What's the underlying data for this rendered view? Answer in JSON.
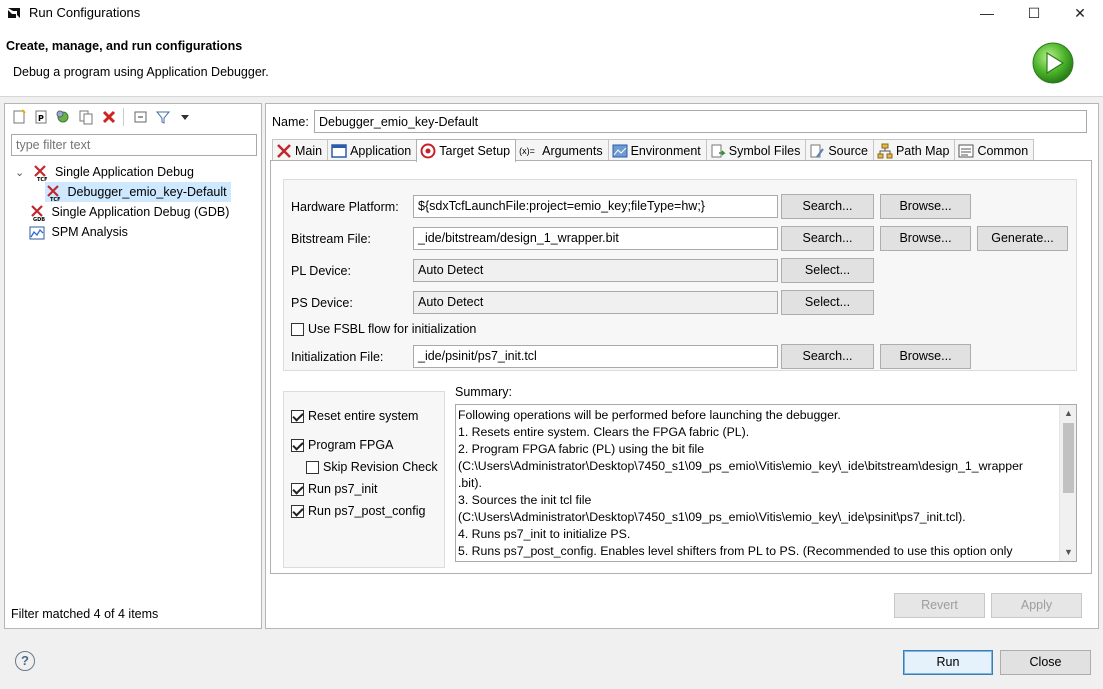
{
  "window": {
    "title": "Run Configurations",
    "controls": {
      "minimize": "—",
      "maximize": "☐",
      "close": "✕"
    }
  },
  "header": {
    "title": "Create, manage, and run configurations",
    "subtitle": "Debug a program using Application Debugger."
  },
  "left_panel": {
    "toolbar_icons": [
      "new-config-icon",
      "new-prototype-icon",
      "export-icon",
      "duplicate-icon",
      "delete-icon",
      "collapse-all-icon",
      "filter-icon",
      "dropdown-arrow-icon"
    ],
    "filter_placeholder": "type filter text",
    "tree": [
      {
        "label": "Single Application Debug",
        "icon": "tcf-icon",
        "expanded": true,
        "expander": "⌄"
      },
      {
        "label": "Debugger_emio_key-Default",
        "icon": "tcf-icon",
        "selected": true
      },
      {
        "label": "Single Application Debug (GDB)",
        "icon": "gdb-icon"
      },
      {
        "label": "SPM Analysis",
        "icon": "spm-chart-icon"
      }
    ],
    "status": "Filter matched 4 of 4 items"
  },
  "right_panel": {
    "name_label": "Name:",
    "name_value": "Debugger_emio_key-Default",
    "tabs": [
      {
        "label": "Main",
        "icon": "xilinx-icon"
      },
      {
        "label": "Application",
        "icon": "application-icon"
      },
      {
        "label": "Target Setup",
        "icon": "target-icon",
        "active": true
      },
      {
        "label": "Arguments",
        "icon": "arguments-icon",
        "icon_text": "(x)="
      },
      {
        "label": "Environment",
        "icon": "environment-icon"
      },
      {
        "label": "Symbol Files",
        "icon": "symbol-files-icon"
      },
      {
        "label": "Source",
        "icon": "source-icon"
      },
      {
        "label": "Path Map",
        "icon": "path-map-icon"
      },
      {
        "label": "Common",
        "icon": "common-icon"
      }
    ],
    "target_setup": {
      "hardware_platform": {
        "label": "Hardware Platform:",
        "value": "${sdxTcfLaunchFile:project=emio_key;fileType=hw;}",
        "search": "Search...",
        "browse": "Browse..."
      },
      "bitstream_file": {
        "label": "Bitstream File:",
        "value": "_ide/bitstream/design_1_wrapper.bit",
        "search": "Search...",
        "browse": "Browse...",
        "generate": "Generate..."
      },
      "pl_device": {
        "label": "PL Device:",
        "value": "Auto Detect",
        "select": "Select..."
      },
      "ps_device": {
        "label": "PS Device:",
        "value": "Auto Detect",
        "select": "Select..."
      },
      "fsbl_flow": {
        "label": "Use FSBL flow for initialization",
        "checked": false
      },
      "init_file": {
        "label": "Initialization File:",
        "value": "_ide/psinit/ps7_init.tcl",
        "search": "Search...",
        "browse": "Browse..."
      },
      "options": [
        {
          "label": "Reset entire system",
          "checked": true
        },
        {
          "label": "Program FPGA",
          "checked": true
        },
        {
          "label": "Skip Revision Check",
          "checked": false
        },
        {
          "label": "Run ps7_init",
          "checked": true
        },
        {
          "label": "Run ps7_post_config",
          "checked": true
        }
      ],
      "summary_label": "Summary:",
      "summary_lines": [
        "Following operations will be performed before launching the debugger.",
        "1. Resets entire system. Clears the FPGA fabric (PL).",
        "2. Program FPGA fabric (PL) using the bit file",
        "(C:\\Users\\Administrator\\Desktop\\7450_s1\\09_ps_emio\\Vitis\\emio_key\\_ide\\bitstream\\design_1_wrapper",
        ".bit).",
        "3. Sources the init tcl file",
        "(C:\\Users\\Administrator\\Desktop\\7450_s1\\09_ps_emio\\Vitis\\emio_key\\_ide\\psinit\\ps7_init.tcl).",
        "4. Runs ps7_init to initialize PS.",
        "5. Runs ps7_post_config. Enables level shifters from PL to PS. (Recommended to use this option only"
      ],
      "scroll_up": "▲",
      "scroll_down": "▼"
    },
    "revert": "Revert",
    "apply": "Apply"
  },
  "footer": {
    "help": "?",
    "run": "Run",
    "close": "Close"
  }
}
